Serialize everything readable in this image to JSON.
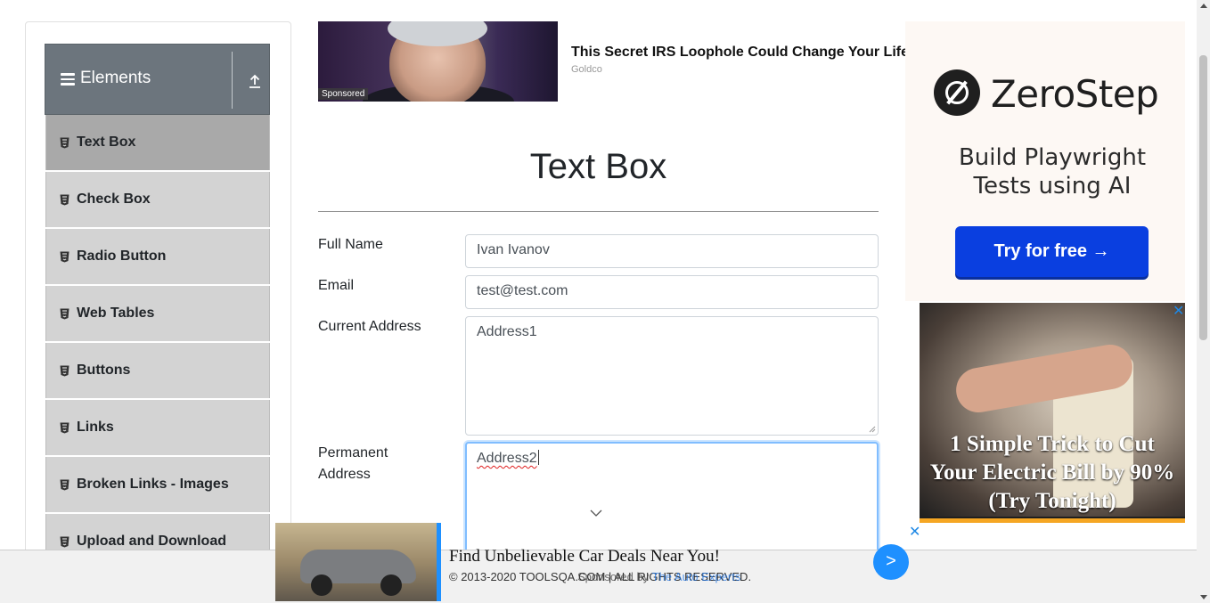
{
  "sidebar": {
    "group_title": "Elements",
    "items": [
      {
        "label": "Text Box",
        "active": true
      },
      {
        "label": "Check Box"
      },
      {
        "label": "Radio Button"
      },
      {
        "label": "Web Tables"
      },
      {
        "label": "Buttons"
      },
      {
        "label": "Links"
      },
      {
        "label": "Broken Links - Images"
      },
      {
        "label": "Upload and Download"
      }
    ]
  },
  "top_ad": {
    "sponsored": "Sponsored",
    "headline": "This Secret IRS Loophole Could Change Your Life",
    "source": "Goldco"
  },
  "form": {
    "title": "Text Box",
    "full_name_label": "Full Name",
    "full_name_value": "Ivan Ivanov",
    "email_label": "Email",
    "email_value": "test@test.com",
    "current_address_label": "Current Address",
    "current_address_value": "Address1",
    "permanent_address_label_line1": "Permanent",
    "permanent_address_label_line2": "Address",
    "permanent_address_value": "Address2"
  },
  "right_ad_top": {
    "brand": "ZeroStep",
    "tagline_line1": "Build Playwright",
    "tagline_line2": "Tests using AI",
    "cta": "Try for free →"
  },
  "right_ad_bottom": {
    "text_line1": "1 Simple Trick to Cut",
    "text_line2": "Your Electric Bill by 90%",
    "text_line3": "(Try Tonight)",
    "close": "✕"
  },
  "bottom_ad": {
    "headline": "Find Unbelievable Car Deals Near You!",
    "close": "✕",
    "go": ">"
  },
  "footer": {
    "copyright": "© 2013-2020 TOOLSQA.COM | ALL RIGHTS RESERVED.",
    "overlay_prefix": "Sponsored by",
    "overlay_link": "The Auto Experts"
  },
  "colors": {
    "sidebar_header": "#6c757d",
    "menu_item": "#d3d3d3",
    "menu_item_active": "#a9a9a9",
    "focus_border": "#80bdff",
    "cta_blue": "#0a3fe0"
  }
}
